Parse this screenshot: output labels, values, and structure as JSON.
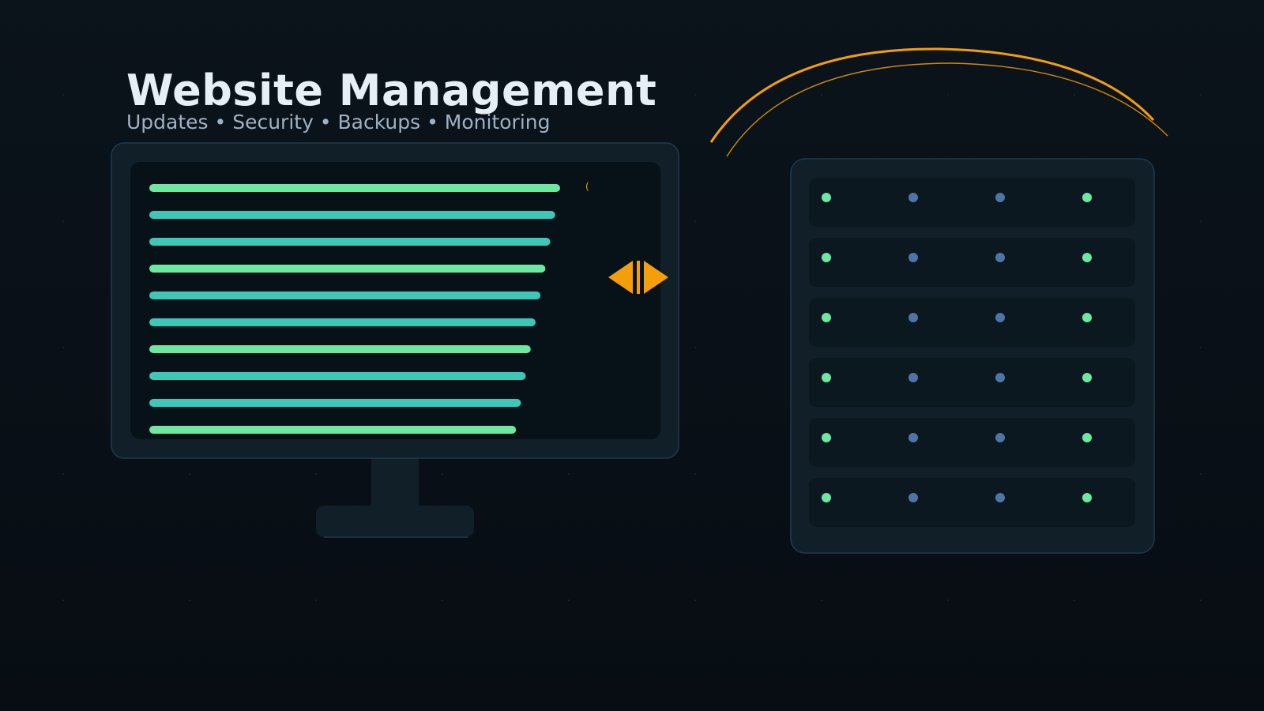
{
  "hero": {
    "title": "Website Management",
    "subtitle": "Updates • Security • Backups • Monitoring"
  },
  "colors": {
    "background": "#0a1219",
    "panel": "#111f29",
    "panel_border": "#1f3a4d",
    "screen": "#071218",
    "green": "#6ee7a0",
    "teal": "#3cc7b8",
    "accent_orange": "#f59e0b",
    "led_blue": "#4f74a6"
  },
  "icons": {
    "screen_overlay": "code-brackets-icon",
    "status_arc": "orbit-arc"
  },
  "monitor": {
    "line_colors": [
      "green",
      "teal",
      "teal",
      "green",
      "teal",
      "teal",
      "green",
      "teal",
      "teal",
      "green"
    ]
  },
  "server": {
    "units": [
      [
        "green",
        "blue",
        "blue",
        "green"
      ],
      [
        "green",
        "blue",
        "blue",
        "green"
      ],
      [
        "green",
        "blue",
        "blue",
        "green"
      ],
      [
        "green",
        "blue",
        "blue",
        "green"
      ],
      [
        "green",
        "blue",
        "blue",
        "green"
      ],
      [
        "green",
        "blue",
        "blue",
        "green"
      ]
    ]
  }
}
